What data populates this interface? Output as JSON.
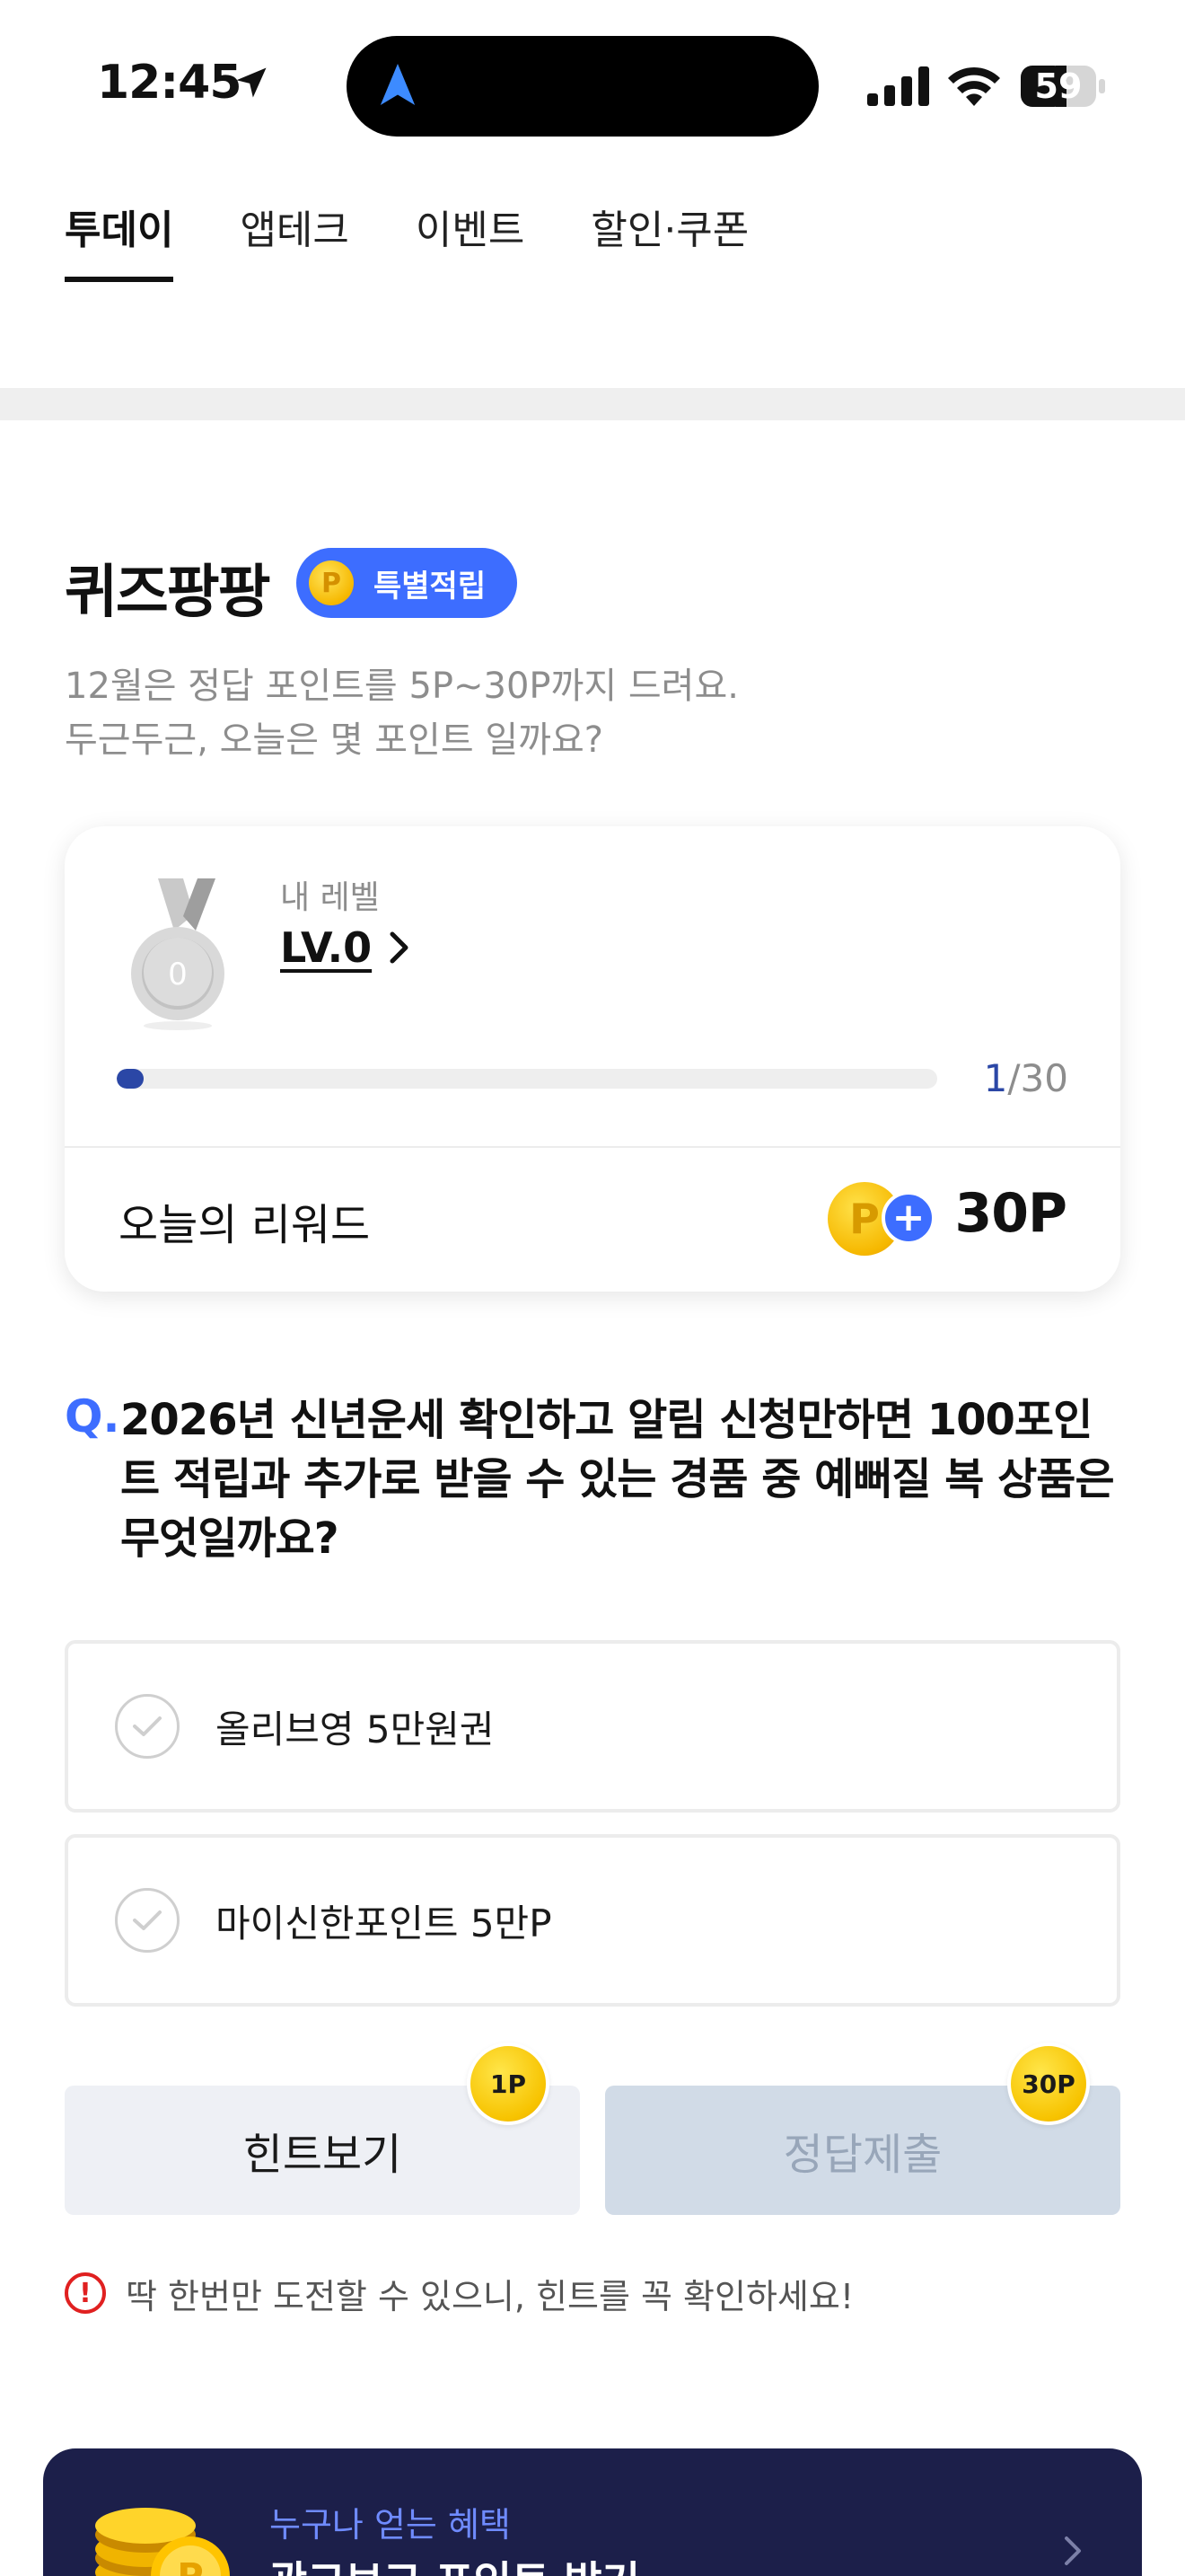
{
  "status_bar": {
    "time": "12:45",
    "battery": "59",
    "icons": [
      "location-arrow-icon",
      "navigation-icon",
      "signal-icon",
      "wifi-icon",
      "battery-icon"
    ]
  },
  "tabs": [
    {
      "label": "투데이",
      "active": true
    },
    {
      "label": "앱테크",
      "active": false
    },
    {
      "label": "이벤트",
      "active": false
    },
    {
      "label": "할인·쿠폰",
      "active": false
    }
  ],
  "quiz": {
    "title": "퀴즈팡팡",
    "badge_label": "특별적립",
    "badge_coin_letter": "P",
    "description_line1": "12월은 정답 포인트를 5P~30P까지 드려요.",
    "description_line2": "두근두근, 오늘은 몇 포인트 일까요?"
  },
  "level_card": {
    "my_level_label": "내 레벨",
    "level": "LV.0",
    "medal_number": "0",
    "progress_current": "1",
    "progress_total": "/30",
    "progress_fraction": 0.033,
    "reward_label": "오늘의 리워드",
    "reward_coin_letter": "P",
    "reward_plus": "+",
    "reward_value": "30P"
  },
  "question": {
    "prefix": "Q.",
    "text": "2026년 신년운세 확인하고 알림 신청만하면 100포인트 적립과 추가로 받을 수 있는 경품 중 예뻐질 복 상품은 무엇일까요?",
    "options": [
      {
        "label": "올리브영 5만원권"
      },
      {
        "label": "마이신한포인트 5만P"
      }
    ]
  },
  "buttons": {
    "hint_label": "힌트보기",
    "hint_points": "1P",
    "submit_label": "정답제출",
    "submit_points": "30P"
  },
  "warning": {
    "icon": "!",
    "text": "딱 한번만 도전할 수 있으니, 힌트를 꼭 확인하세요!"
  },
  "banner": {
    "subtitle": "누구나 얻는 혜택",
    "title": "광고보고 포인트 받기"
  },
  "colors": {
    "accent": "#3d6dff",
    "progress": "#2b47a6",
    "coin": "#f6b800",
    "warning": "#e02020",
    "banner_bg": "#1c1f4a"
  }
}
